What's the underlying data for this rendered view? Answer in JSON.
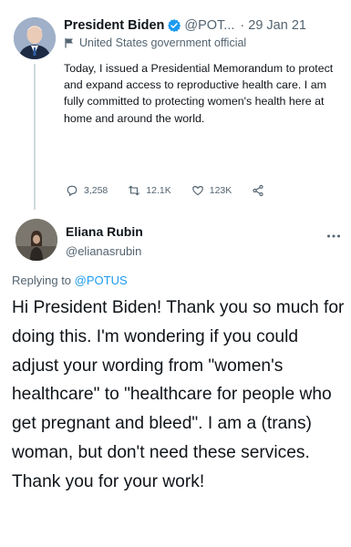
{
  "parent_tweet": {
    "author_name": "President Biden",
    "handle": "@POT...",
    "separator": "·",
    "date": "29 Jan 21",
    "label": "United States government official",
    "text": "Today, I issued a Presidential Memorandum to protect and expand access to reproductive health care. I am fully committed to protecting women's health here at home and around the world.",
    "stats": {
      "replies": "3,258",
      "retweets": "12.1K",
      "likes": "123K"
    }
  },
  "reply_tweet": {
    "author_name": "Eliana Rubin",
    "handle": "@elianasrubin",
    "replying_prefix": "Replying to",
    "replying_to": "@POTUS",
    "text": "Hi President Biden! Thank you so much for doing this. I'm wondering if you could adjust your wording from \"women's healthcare\" to \"healthcare for people who get pregnant and bleed\". I am a (trans) woman, but don't need these services. Thank you for your work!"
  },
  "icons": {
    "verified": "verified-badge-icon",
    "flag": "flag-icon",
    "reply": "reply-icon",
    "retweet": "retweet-icon",
    "like": "heart-icon",
    "share": "share-icon",
    "more": "more-icon"
  },
  "colors": {
    "accent": "#1d9bf0",
    "text": "#0f1419",
    "secondary": "#536471",
    "divider": "#cfd9de"
  }
}
